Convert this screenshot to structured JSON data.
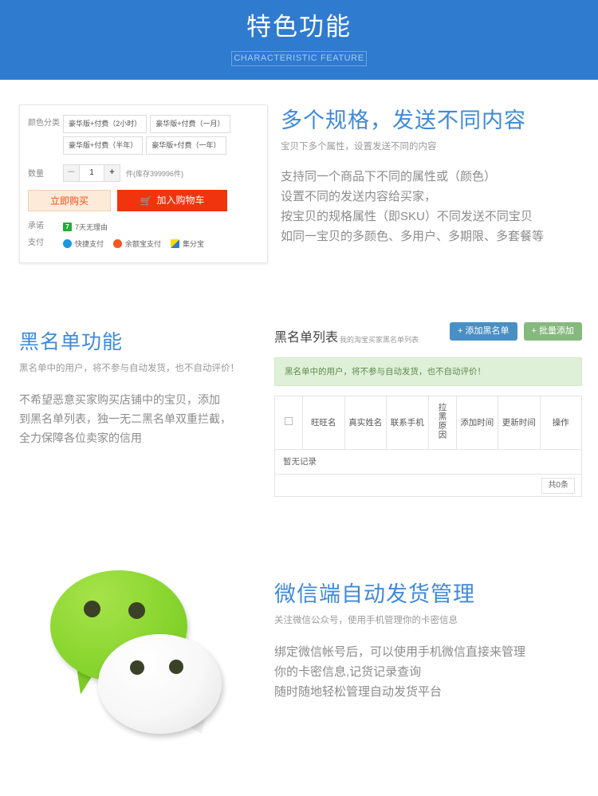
{
  "banner": {
    "title": "特色功能",
    "subtitle": "CHARACTERISTIC FEATURE",
    "bg_color": "#2f7bd0"
  },
  "section_sku": {
    "card": {
      "color_label": "颜色分类",
      "options": [
        "豪华版+付费（2小时）",
        "豪华版+付费（一月）",
        "豪华版+付费（半年）",
        "豪华版+付费（一年）"
      ],
      "qty_label": "数量",
      "qty_minus": "－",
      "qty_value": "1",
      "qty_plus": "+",
      "stock_text": "件(库存399996件)",
      "buy_now": "立即购买",
      "add_cart": "加入购物车",
      "cart_icon": "cart-icon",
      "promise_label": "承诺",
      "promise_icon_text": "7",
      "promise_text": "7天无理由",
      "pay_label": "支付",
      "payments": [
        {
          "icon": "kuaijie-pay-icon",
          "label": "快捷支付"
        },
        {
          "icon": "yuebao-pay-icon",
          "label": "余额宝支付"
        },
        {
          "icon": "jifenbao-icon",
          "label": "集分宝"
        }
      ]
    },
    "title": "多个规格，发送不同内容",
    "subtitle": "宝贝下多个属性，设置发送不同的内容",
    "body": [
      "支持同一个商品下不同的属性或（颜色）",
      "设置不同的发送内容给买家，",
      "按宝贝的规格属性（即SKU）不同发送不同宝贝",
      "如同一宝贝的多颜色、多用户、多期限、多套餐等"
    ]
  },
  "section_blacklist": {
    "title": "黑名单功能",
    "subtitle": "黑名单中的用户，将不参与自动发货，也不自动评价！",
    "body": [
      "不希望恶意买家购买店铺中的宝贝，添加",
      "到黑名单列表，独一无二黑名单双重拦截，",
      "全力保障各位卖家的信用"
    ],
    "panel": {
      "heading": "黑名单列表",
      "heading_sub": "我的淘宝买家黑名单列表",
      "add_button": "+ 添加黑名单",
      "batch_button": "+ 批量添加",
      "add_button_color": "#4a8fc4",
      "batch_button_color": "#86b97d",
      "alert": "黑名单中的用户，将不参与自动发货，也不自动评价！",
      "alert_bg": "#dff0d8",
      "columns": [
        "旺旺名",
        "真实姓名",
        "联系手机",
        "拉黑原因",
        "添加时间",
        "更新时间",
        "操作"
      ],
      "empty_text": "暂无记录",
      "count_text": "共0条"
    }
  },
  "section_wechat": {
    "logo_icon": "wechat-logo-icon",
    "title": "微信端自动发货管理",
    "subtitle": "关注微信公众号，使用手机管理你的卡密信息",
    "body": [
      "绑定微信帐号后，可以使用手机微信直接来管理",
      "你的卡密信息,记货记录查询",
      "随时随地轻松管理自动发货平台"
    ]
  }
}
